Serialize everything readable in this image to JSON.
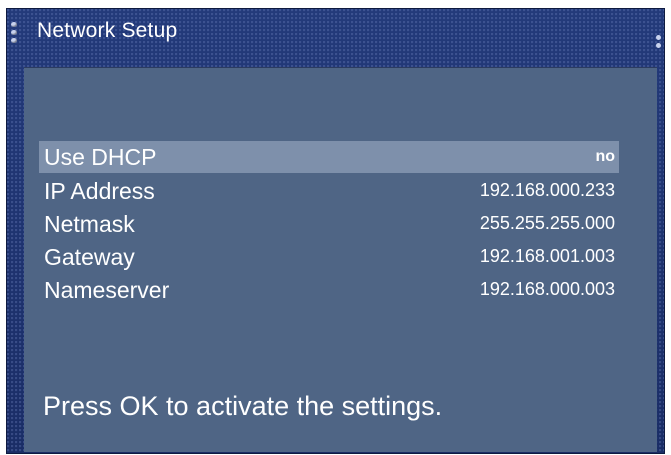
{
  "window": {
    "title": "Network Setup"
  },
  "settings": [
    {
      "label": "Use DHCP",
      "value": "no",
      "selected": true
    },
    {
      "label": "IP Address",
      "value": "192.168.000.233",
      "selected": false
    },
    {
      "label": "Netmask",
      "value": "255.255.255.000",
      "selected": false
    },
    {
      "label": "Gateway",
      "value": "192.168.001.003",
      "selected": false
    },
    {
      "label": "Nameserver",
      "value": "192.168.000.003",
      "selected": false
    }
  ],
  "hint": "Press OK to activate the settings.",
  "colors": {
    "frame": "#1b2f6a",
    "panel": "#4f6585",
    "highlight": "#7e90ab",
    "text": "#ffffff"
  }
}
